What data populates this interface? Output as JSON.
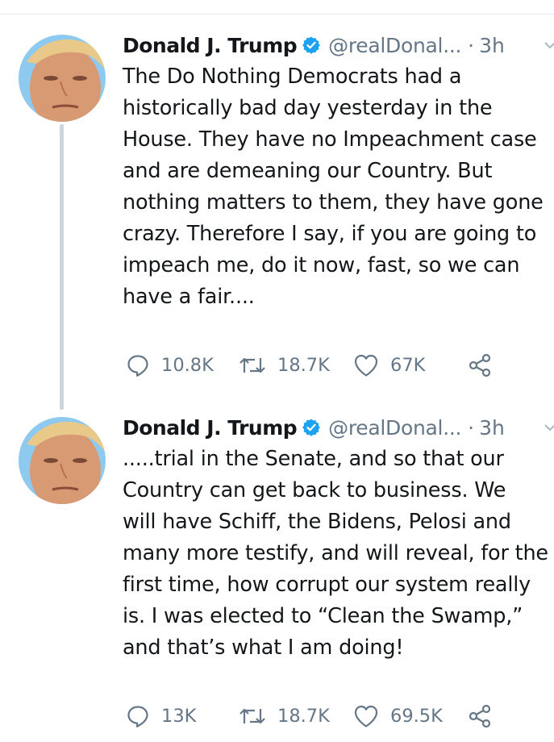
{
  "tweets": [
    {
      "author": {
        "name": "Donald J. Trump",
        "handle": "@realDonal...",
        "verified_icon": "verified-badge-icon",
        "avatar": "profile-photo"
      },
      "separator": "·",
      "time": "3h",
      "text_lines": [
        "The Do Nothing Democrats had a",
        "historically bad day yesterday in the",
        "House. They have no Impeachment case",
        "and are demeaning our Country. But",
        "nothing matters to them, they have gone",
        "crazy. Therefore I say, if you are going to",
        "impeach me, do it now, fast, so we can",
        "have a fair...."
      ],
      "replies": "10.8K",
      "retweets": "18.7K",
      "likes": "67K"
    },
    {
      "author": {
        "name": "Donald J. Trump",
        "handle": "@realDonal...",
        "verified_icon": "verified-badge-icon",
        "avatar": "profile-photo"
      },
      "separator": "·",
      "time": "3h",
      "text_lines": [
        ".....trial in the Senate, and so that our",
        "Country can get back to business. We",
        "will have Schiff, the Bidens, Pelosi and",
        "many more testify, and will reveal, for the",
        "first time, how corrupt our system really",
        "is. I was elected to “Clean the Swamp,”",
        "and that’s what I am doing!"
      ],
      "replies": "13K",
      "retweets": "18.7K",
      "likes": "69.5K"
    }
  ],
  "colors": {
    "text": "#14171a",
    "muted": "#657786",
    "verified": "#1da1f2",
    "thread_line": "#ccd6dd",
    "divider": "#e6ecf0"
  },
  "icons": {
    "reply": "reply-bubble-icon",
    "retweet": "retweet-icon",
    "like": "heart-icon",
    "share": "share-icon",
    "menu": "chevron-down-icon"
  }
}
